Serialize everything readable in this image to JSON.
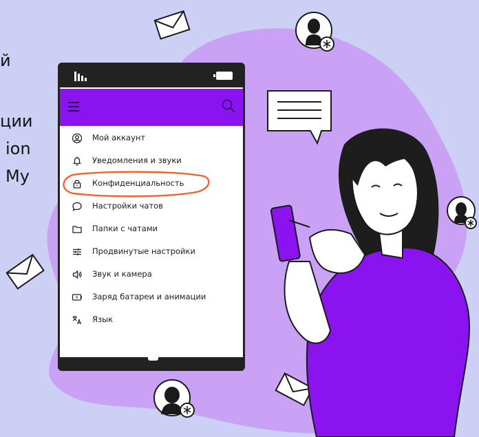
{
  "background_text": {
    "line1": "й",
    "line2": "ции",
    "line3": "ion",
    "line4": "My"
  },
  "phone": {
    "app_bar": {
      "menu_icon": "hamburger-icon",
      "search_icon": "search-icon",
      "color": "#8a13f0"
    },
    "menu": {
      "items": [
        {
          "label": "Мой аккаунт",
          "icon": "account-icon"
        },
        {
          "label": "Уведомления и звуки",
          "icon": "bell-icon"
        },
        {
          "label": "Конфиденциальность",
          "icon": "lock-icon",
          "highlighted": true
        },
        {
          "label": "Настройки чатов",
          "icon": "chat-bubble-icon"
        },
        {
          "label": "Папки с чатами",
          "icon": "folder-icon"
        },
        {
          "label": "Продвинутые настройки",
          "icon": "sliders-icon"
        },
        {
          "label": "Звук и камера",
          "icon": "speaker-icon"
        },
        {
          "label": "Заряд батареи и анимации",
          "icon": "battery-icon"
        },
        {
          "label": "Язык",
          "icon": "translate-icon"
        }
      ]
    },
    "highlight_color": "#f0632e"
  },
  "colors": {
    "background": "#cdd0f5",
    "blob": "#c9a2f5",
    "accent": "#8a13f0"
  }
}
